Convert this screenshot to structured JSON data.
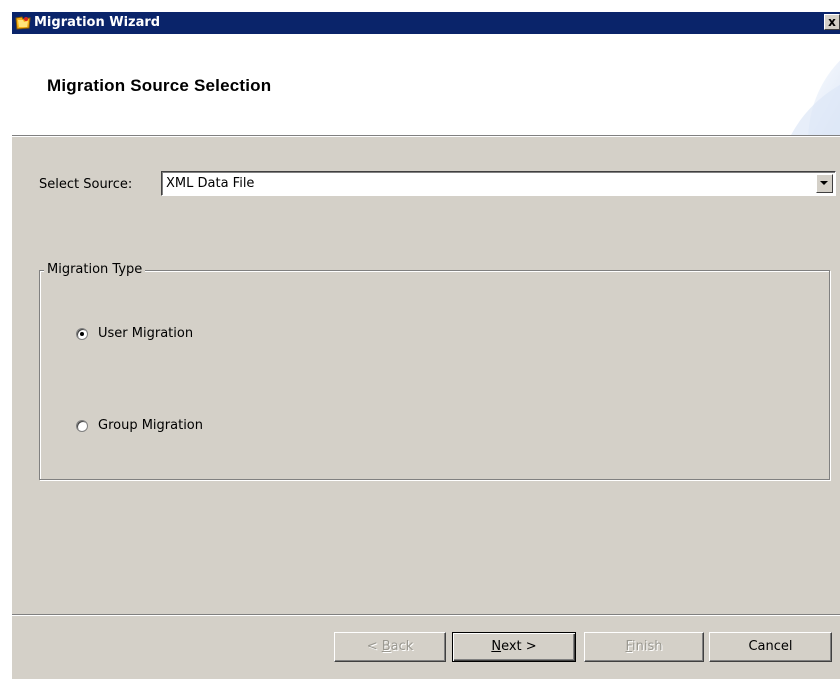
{
  "window": {
    "title": "Migration Wizard",
    "close_label": "x"
  },
  "header": {
    "title": "Migration Source Selection"
  },
  "source": {
    "label": "Select Source:",
    "value": "XML Data File"
  },
  "migration_type": {
    "legend": "Migration Type",
    "options": [
      {
        "label": "User Migration",
        "selected": true
      },
      {
        "label": "Group Migration",
        "selected": false
      }
    ]
  },
  "buttons": {
    "back": {
      "prefix": "< ",
      "mnemonic": "B",
      "rest": "ack",
      "enabled": false
    },
    "next": {
      "prefix": "",
      "mnemonic": "N",
      "rest": "ext >",
      "enabled": true
    },
    "finish": {
      "prefix": "",
      "mnemonic": "F",
      "rest": "inish",
      "enabled": false
    },
    "cancel": {
      "label": "Cancel",
      "enabled": true
    }
  },
  "colors": {
    "titlebar": "#0a246a",
    "dialog_face": "#d4d0c8",
    "header_bg": "#ffffff",
    "disabled_text": "#9a9890"
  },
  "icons": {
    "app": "wizard-app-icon",
    "close": "close-icon",
    "dropdown": "chevron-down-icon"
  }
}
